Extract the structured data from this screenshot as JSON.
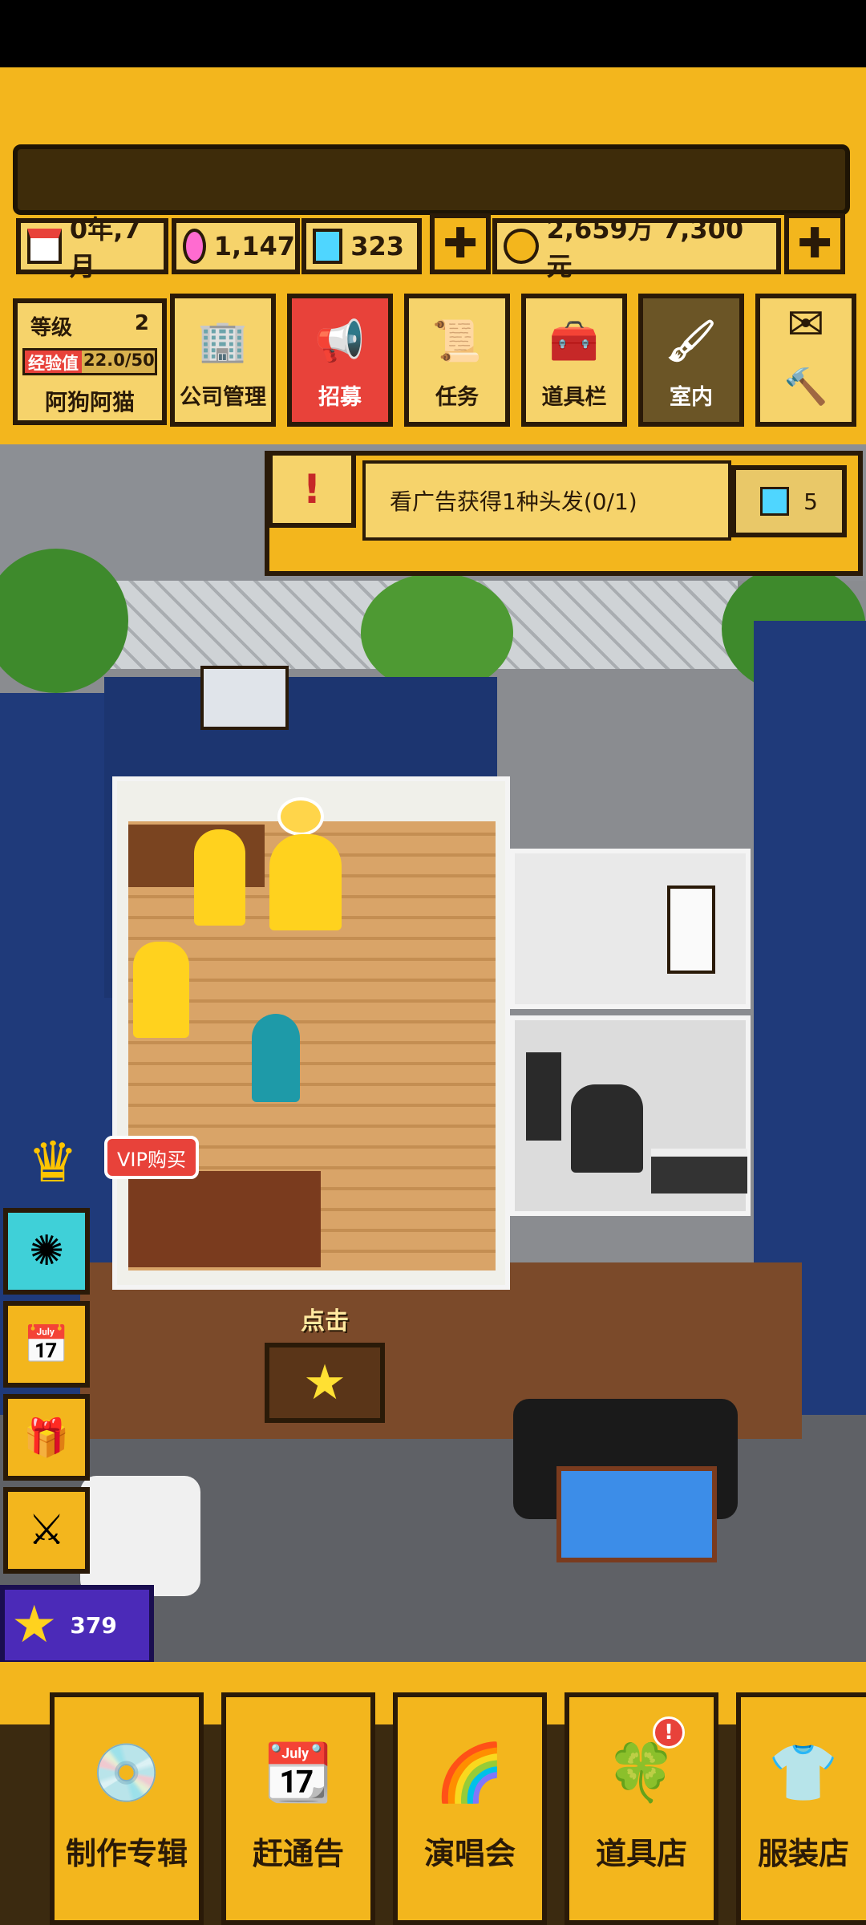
{
  "resources": {
    "date": "0年,7月",
    "gems": "1,147",
    "diamonds": "323",
    "money": "2,659万 7,300元"
  },
  "player": {
    "level_label": "等级",
    "level": "2",
    "exp_label": "经验值",
    "exp": "22.0/50",
    "exp_progress": 0.44,
    "name": "阿狗阿猫"
  },
  "top_menu": [
    {
      "label": "公司管理",
      "icon": "building-icon"
    },
    {
      "label": "招募",
      "icon": "megaphone-icon"
    },
    {
      "label": "任务",
      "icon": "scroll-icon"
    },
    {
      "label": "道具栏",
      "icon": "chest-icon"
    },
    {
      "label": "室内",
      "icon": "paint-roller-icon"
    }
  ],
  "task": {
    "text": "看广告获得1种头发(0/1)",
    "reward": "5"
  },
  "side": {
    "vip_label": "VIP购买",
    "stars": "379"
  },
  "scene": {
    "click_label": "点击"
  },
  "bottom_nav": [
    {
      "label": "制作专辑",
      "icon": "cd-icon"
    },
    {
      "label": "赶通告",
      "icon": "calendar-icon"
    },
    {
      "label": "演唱会",
      "icon": "rainbow-screen-icon"
    },
    {
      "label": "道具店",
      "icon": "clover-icon",
      "badge": "!"
    },
    {
      "label": "服装店",
      "icon": "shirt-icon"
    }
  ],
  "colors": {
    "hud_yellow": "#f3b61d",
    "panel_yellow": "#f6d36b",
    "outline": "#2a1a08",
    "recruit_red": "#e8423a",
    "star_purple": "#4b2ab8"
  }
}
